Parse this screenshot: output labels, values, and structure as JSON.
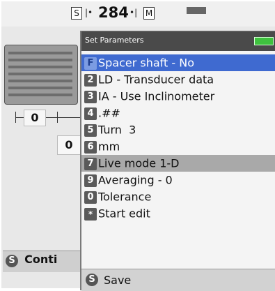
{
  "background": {
    "left_marker": "S",
    "right_marker": "M",
    "distance_value": "284",
    "value_1": "0",
    "value_2": "0",
    "footer_key": "S",
    "footer_label": "Conti"
  },
  "dialog": {
    "title": "Set Parameters",
    "items": [
      {
        "key": "F",
        "label": "Spacer shaft - No"
      },
      {
        "key": "2",
        "label": "LD - Transducer data"
      },
      {
        "key": "3",
        "label": "IA - Use Inclinometer"
      },
      {
        "key": "4",
        "label": ".##"
      },
      {
        "key": "5",
        "label": "Turn  3"
      },
      {
        "key": "6",
        "label": "mm"
      },
      {
        "key": "7",
        "label": "Live mode 1-D"
      },
      {
        "key": "9",
        "label": "Averaging - 0"
      },
      {
        "key": "0",
        "label": "Tolerance"
      },
      {
        "key": "*",
        "label": "Start edit"
      }
    ],
    "selected_index": 0,
    "highlight_index": 6,
    "footer_key": "S",
    "footer_label": "Save"
  },
  "colors": {
    "selection": "#3f6ad0",
    "highlight": "#a9a9a9",
    "title_bar": "#4a4a4a",
    "battery": "#3fc23f"
  },
  "icons": {
    "battery": "battery-icon",
    "key_badge": "key-badge-icon"
  }
}
